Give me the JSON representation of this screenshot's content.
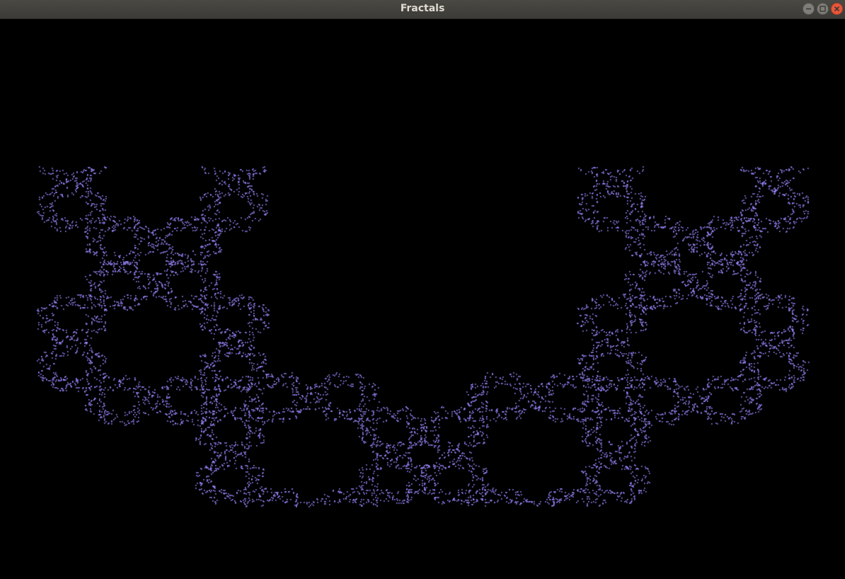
{
  "window": {
    "title": "Fractals"
  },
  "controls": {
    "minimize_icon": "minimize-icon",
    "maximize_icon": "maximize-icon",
    "close_icon": "close-icon"
  },
  "colors": {
    "titlebar": "#3c3b37",
    "background": "#000000",
    "points": "#9b87ff",
    "close": "#e9573b"
  }
}
